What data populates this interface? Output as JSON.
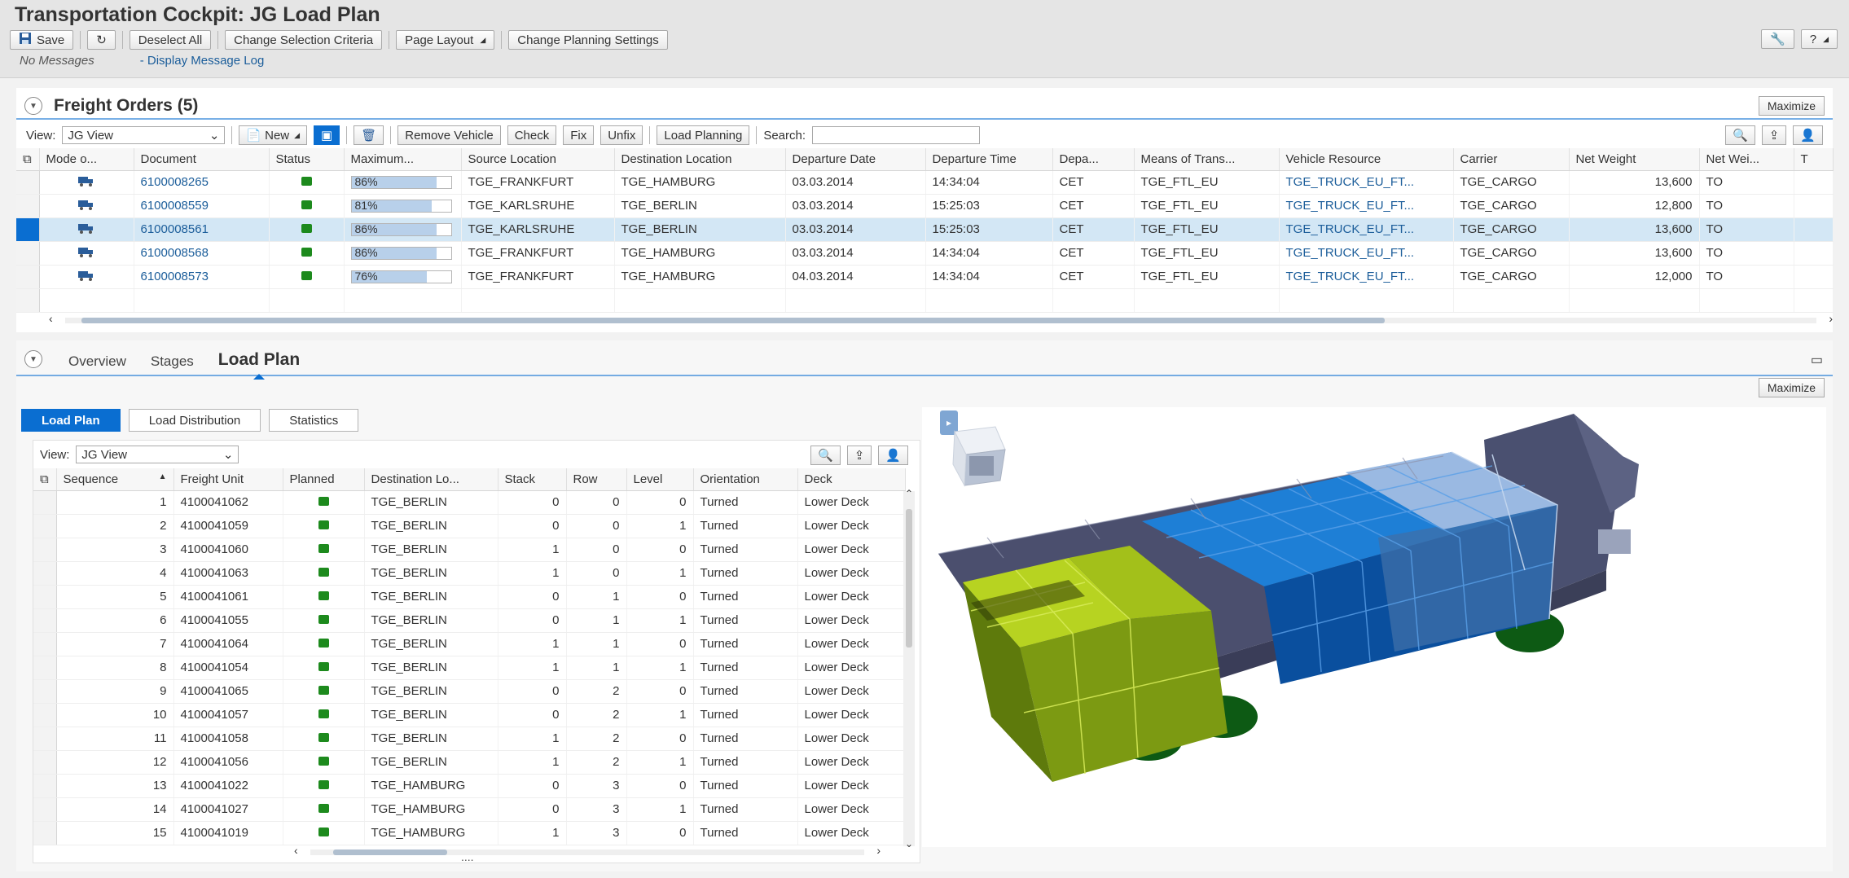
{
  "app": {
    "title": "Transportation Cockpit: JG Load Plan",
    "toolbar": {
      "save": "Save",
      "deselect_all": "Deselect All",
      "change_selection": "Change Selection Criteria",
      "page_layout": "Page Layout",
      "change_planning": "Change Planning Settings"
    },
    "messages": {
      "status": "No Messages",
      "log_link": "Display Message Log"
    }
  },
  "freight_orders": {
    "title": "Freight Orders (5)",
    "maximize": "Maximize",
    "view_label": "View:",
    "view_value": "JG View",
    "buttons": {
      "new": "New",
      "remove_vehicle": "Remove Vehicle",
      "check": "Check",
      "fix": "Fix",
      "unfix": "Unfix",
      "load_planning": "Load Planning"
    },
    "search_label": "Search:",
    "search_value": "",
    "columns": [
      "Mode o...",
      "Document",
      "Status",
      "Maximum...",
      "Source Location",
      "Destination Location",
      "Departure Date",
      "Departure Time",
      "Depa...",
      "Means of Trans...",
      "Vehicle Resource",
      "Carrier",
      "Net Weight",
      "Net Wei...",
      "T"
    ],
    "rows": [
      {
        "doc": "6100008265",
        "util": "86%",
        "util_value": 86,
        "src": "TGE_FRANKFURT",
        "dst": "TGE_HAMBURG",
        "date": "03.03.2014",
        "time": "14:34:04",
        "tz": "CET",
        "mtr": "TGE_FTL_EU",
        "res": "TGE_TRUCK_EU_FT...",
        "carrier": "TGE_CARGO",
        "weight": "13,600",
        "uom": "TO"
      },
      {
        "doc": "6100008559",
        "util": "81%",
        "util_value": 81,
        "src": "TGE_KARLSRUHE",
        "dst": "TGE_BERLIN",
        "date": "03.03.2014",
        "time": "15:25:03",
        "tz": "CET",
        "mtr": "TGE_FTL_EU",
        "res": "TGE_TRUCK_EU_FT...",
        "carrier": "TGE_CARGO",
        "weight": "12,800",
        "uom": "TO"
      },
      {
        "doc": "6100008561",
        "util": "86%",
        "util_value": 86,
        "src": "TGE_KARLSRUHE",
        "dst": "TGE_BERLIN",
        "date": "03.03.2014",
        "time": "15:25:03",
        "tz": "CET",
        "mtr": "TGE_FTL_EU",
        "res": "TGE_TRUCK_EU_FT...",
        "carrier": "TGE_CARGO",
        "weight": "13,600",
        "uom": "TO"
      },
      {
        "doc": "6100008568",
        "util": "86%",
        "util_value": 86,
        "src": "TGE_FRANKFURT",
        "dst": "TGE_HAMBURG",
        "date": "03.03.2014",
        "time": "14:34:04",
        "tz": "CET",
        "mtr": "TGE_FTL_EU",
        "res": "TGE_TRUCK_EU_FT...",
        "carrier": "TGE_CARGO",
        "weight": "13,600",
        "uom": "TO"
      },
      {
        "doc": "6100008573",
        "util": "76%",
        "util_value": 76,
        "src": "TGE_FRANKFURT",
        "dst": "TGE_HAMBURG",
        "date": "04.03.2014",
        "time": "14:34:04",
        "tz": "CET",
        "mtr": "TGE_FTL_EU",
        "res": "TGE_TRUCK_EU_FT...",
        "carrier": "TGE_CARGO",
        "weight": "12,000",
        "uom": "TO"
      }
    ]
  },
  "detail": {
    "tabs": [
      "Overview",
      "Stages",
      "Load Plan"
    ],
    "maximize": "Maximize",
    "subtabs": [
      "Load Plan",
      "Load Distribution",
      "Statistics"
    ],
    "view_label": "View:",
    "view_value": "JG View",
    "columns": [
      "Sequence",
      "Freight Unit",
      "Planned",
      "Destination Lo...",
      "Stack",
      "Row",
      "Level",
      "Orientation",
      "Deck"
    ],
    "rows": [
      {
        "seq": "1",
        "fu": "4100041062",
        "dst": "TGE_BERLIN",
        "stack": "0",
        "row": "0",
        "level": "0",
        "orient": "Turned",
        "deck": "Lower Deck"
      },
      {
        "seq": "2",
        "fu": "4100041059",
        "dst": "TGE_BERLIN",
        "stack": "0",
        "row": "0",
        "level": "1",
        "orient": "Turned",
        "deck": "Lower Deck"
      },
      {
        "seq": "3",
        "fu": "4100041060",
        "dst": "TGE_BERLIN",
        "stack": "1",
        "row": "0",
        "level": "0",
        "orient": "Turned",
        "deck": "Lower Deck"
      },
      {
        "seq": "4",
        "fu": "4100041063",
        "dst": "TGE_BERLIN",
        "stack": "1",
        "row": "0",
        "level": "1",
        "orient": "Turned",
        "deck": "Lower Deck"
      },
      {
        "seq": "5",
        "fu": "4100041061",
        "dst": "TGE_BERLIN",
        "stack": "0",
        "row": "1",
        "level": "0",
        "orient": "Turned",
        "deck": "Lower Deck"
      },
      {
        "seq": "6",
        "fu": "4100041055",
        "dst": "TGE_BERLIN",
        "stack": "0",
        "row": "1",
        "level": "1",
        "orient": "Turned",
        "deck": "Lower Deck"
      },
      {
        "seq": "7",
        "fu": "4100041064",
        "dst": "TGE_BERLIN",
        "stack": "1",
        "row": "1",
        "level": "0",
        "orient": "Turned",
        "deck": "Lower Deck"
      },
      {
        "seq": "8",
        "fu": "4100041054",
        "dst": "TGE_BERLIN",
        "stack": "1",
        "row": "1",
        "level": "1",
        "orient": "Turned",
        "deck": "Lower Deck"
      },
      {
        "seq": "9",
        "fu": "4100041065",
        "dst": "TGE_BERLIN",
        "stack": "0",
        "row": "2",
        "level": "0",
        "orient": "Turned",
        "deck": "Lower Deck"
      },
      {
        "seq": "10",
        "fu": "4100041057",
        "dst": "TGE_BERLIN",
        "stack": "0",
        "row": "2",
        "level": "1",
        "orient": "Turned",
        "deck": "Lower Deck"
      },
      {
        "seq": "11",
        "fu": "4100041058",
        "dst": "TGE_BERLIN",
        "stack": "1",
        "row": "2",
        "level": "0",
        "orient": "Turned",
        "deck": "Lower Deck"
      },
      {
        "seq": "12",
        "fu": "4100041056",
        "dst": "TGE_BERLIN",
        "stack": "1",
        "row": "2",
        "level": "1",
        "orient": "Turned",
        "deck": "Lower Deck"
      },
      {
        "seq": "13",
        "fu": "4100041022",
        "dst": "TGE_HAMBURG",
        "stack": "0",
        "row": "3",
        "level": "0",
        "orient": "Turned",
        "deck": "Lower Deck"
      },
      {
        "seq": "14",
        "fu": "4100041027",
        "dst": "TGE_HAMBURG",
        "stack": "0",
        "row": "3",
        "level": "1",
        "orient": "Turned",
        "deck": "Lower Deck"
      },
      {
        "seq": "15",
        "fu": "4100041019",
        "dst": "TGE_HAMBURG",
        "stack": "1",
        "row": "3",
        "level": "0",
        "orient": "Turned",
        "deck": "Lower Deck"
      }
    ]
  },
  "colors": {
    "accent": "#0a6ed1",
    "status_green": "#1d8a1d",
    "cargo_green": "#a8c81e",
    "cargo_blue": "#0a6ed1",
    "truck": "#4a5070"
  }
}
